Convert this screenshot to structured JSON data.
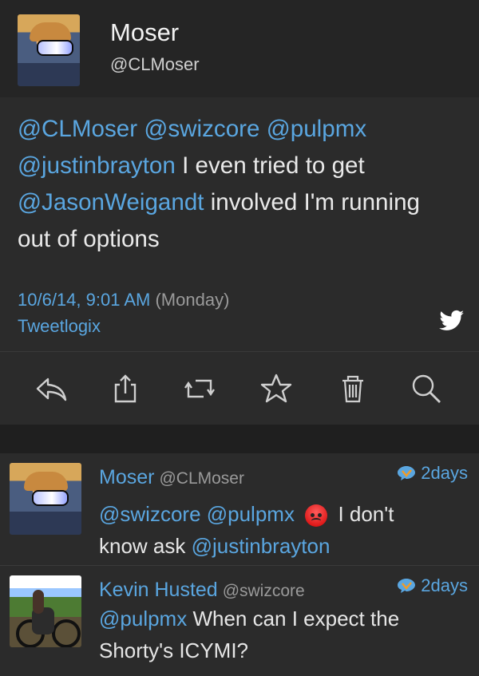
{
  "profile": {
    "name": "Moser",
    "handle": "@CLMoser"
  },
  "main_tweet": {
    "text_segments": [
      {
        "text": "@CLMoser",
        "type": "mention"
      },
      {
        "text": " ",
        "type": "text"
      },
      {
        "text": "@swizcore",
        "type": "mention"
      },
      {
        "text": " ",
        "type": "text"
      },
      {
        "text": "@pulpmx",
        "type": "mention"
      },
      {
        "text": " ",
        "type": "text"
      },
      {
        "text": "@justinbrayton",
        "type": "mention"
      },
      {
        "text": " I even tried to get ",
        "type": "text"
      },
      {
        "text": "@JasonWeigandt",
        "type": "mention"
      },
      {
        "text": " involved I'm running out of options",
        "type": "text"
      }
    ],
    "date": "10/6/14, 9:01 AM",
    "weekday": "(Monday)",
    "client": "Tweetlogix",
    "bird_icon": "twitter-bird-icon"
  },
  "actions": {
    "reply_icon": "reply-icon",
    "share_icon": "share-icon",
    "retweet_icon": "retweet-icon",
    "favorite_icon": "star-icon",
    "delete_icon": "trash-icon",
    "search_icon": "search-icon"
  },
  "timeline": [
    {
      "name": "Moser",
      "handle": "@CLMoser",
      "time": "2days",
      "text_before": "@swizcore @pulpmx",
      "emoji": "angry-face",
      "text_after": "I don't",
      "text_line2_prefix": "know ask ",
      "text_line2_mention": "@justinbrayton"
    },
    {
      "name": "Kevin Husted",
      "handle": "@swizcore",
      "time": "2days",
      "mention": "@pulpmx",
      "text": " When can I expect the Shorty's ICYMI?"
    }
  ],
  "colors": {
    "background": "#252525",
    "panel": "#2b2b2b",
    "accent": "#5aa6e0",
    "text": "#e6e6e6",
    "muted": "#9a9a9a"
  }
}
